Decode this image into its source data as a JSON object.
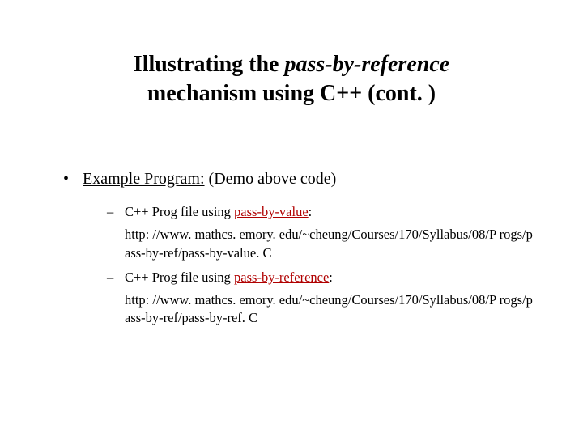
{
  "title": {
    "prefix": "Illustrating the ",
    "italic": "pass-by-reference",
    "line2": "mechanism using C++ (cont. )"
  },
  "body": {
    "lead": "Example Program:",
    "lead_after": " (Demo above code)",
    "items": [
      {
        "prefix": "C++ Prog file using ",
        "highlight": "pass-by-value",
        "suffix": ":",
        "url": "http: //www. mathcs. emory. edu/~cheung/Courses/170/Syllabus/08/P rogs/pass-by-ref/pass-by-value. C"
      },
      {
        "prefix": "C++ Prog file using ",
        "highlight": "pass-by-reference",
        "suffix": ":",
        "url": "http: //www. mathcs. emory. edu/~cheung/Courses/170/Syllabus/08/P rogs/pass-by-ref/pass-by-ref. C"
      }
    ]
  }
}
